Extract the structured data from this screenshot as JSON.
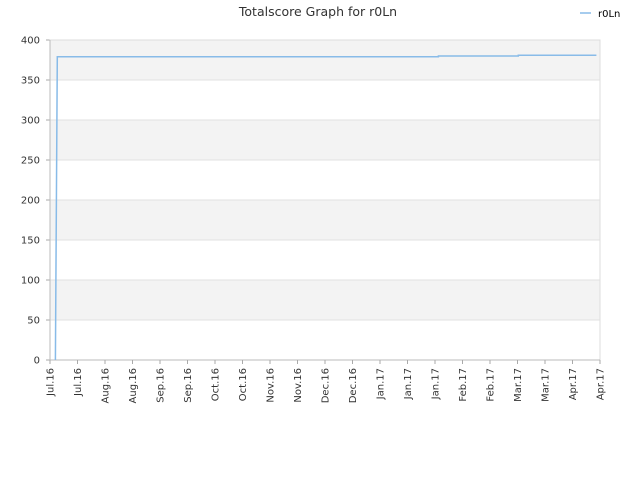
{
  "chart_data": {
    "type": "line",
    "title": "Totalscore Graph for r0Ln",
    "xlabel": "",
    "ylabel": "",
    "ylim": [
      0,
      400
    ],
    "yticks": [
      0,
      50,
      100,
      150,
      200,
      250,
      300,
      350,
      400
    ],
    "x_tick_labels": [
      "Jul.16",
      "Jul.16",
      "Aug.16",
      "Aug.16",
      "Sep.16",
      "Sep.16",
      "Oct.16",
      "Oct.16",
      "Nov.16",
      "Nov.16",
      "Dec.16",
      "Dec.16",
      "Jan.17",
      "Jan.17",
      "Jan.17",
      "Feb.17",
      "Feb.17",
      "Mar.17",
      "Mar.17",
      "Apr.17",
      "Apr.17"
    ],
    "xlim": [
      "2016-07-01",
      "2017-04-30"
    ],
    "grid": "horizontal-bands",
    "legend_position": "top-right",
    "series": [
      {
        "name": "r0Ln",
        "color": "#88bbe8",
        "points": [
          {
            "x": "2016-07-04",
            "y": 0
          },
          {
            "x": "2016-07-05",
            "y": 379
          },
          {
            "x": "2017-01-31",
            "y": 379
          },
          {
            "x": "2017-01-31",
            "y": 380
          },
          {
            "x": "2017-03-16",
            "y": 380
          },
          {
            "x": "2017-03-16",
            "y": 381
          },
          {
            "x": "2017-04-28",
            "y": 381
          }
        ]
      }
    ]
  }
}
